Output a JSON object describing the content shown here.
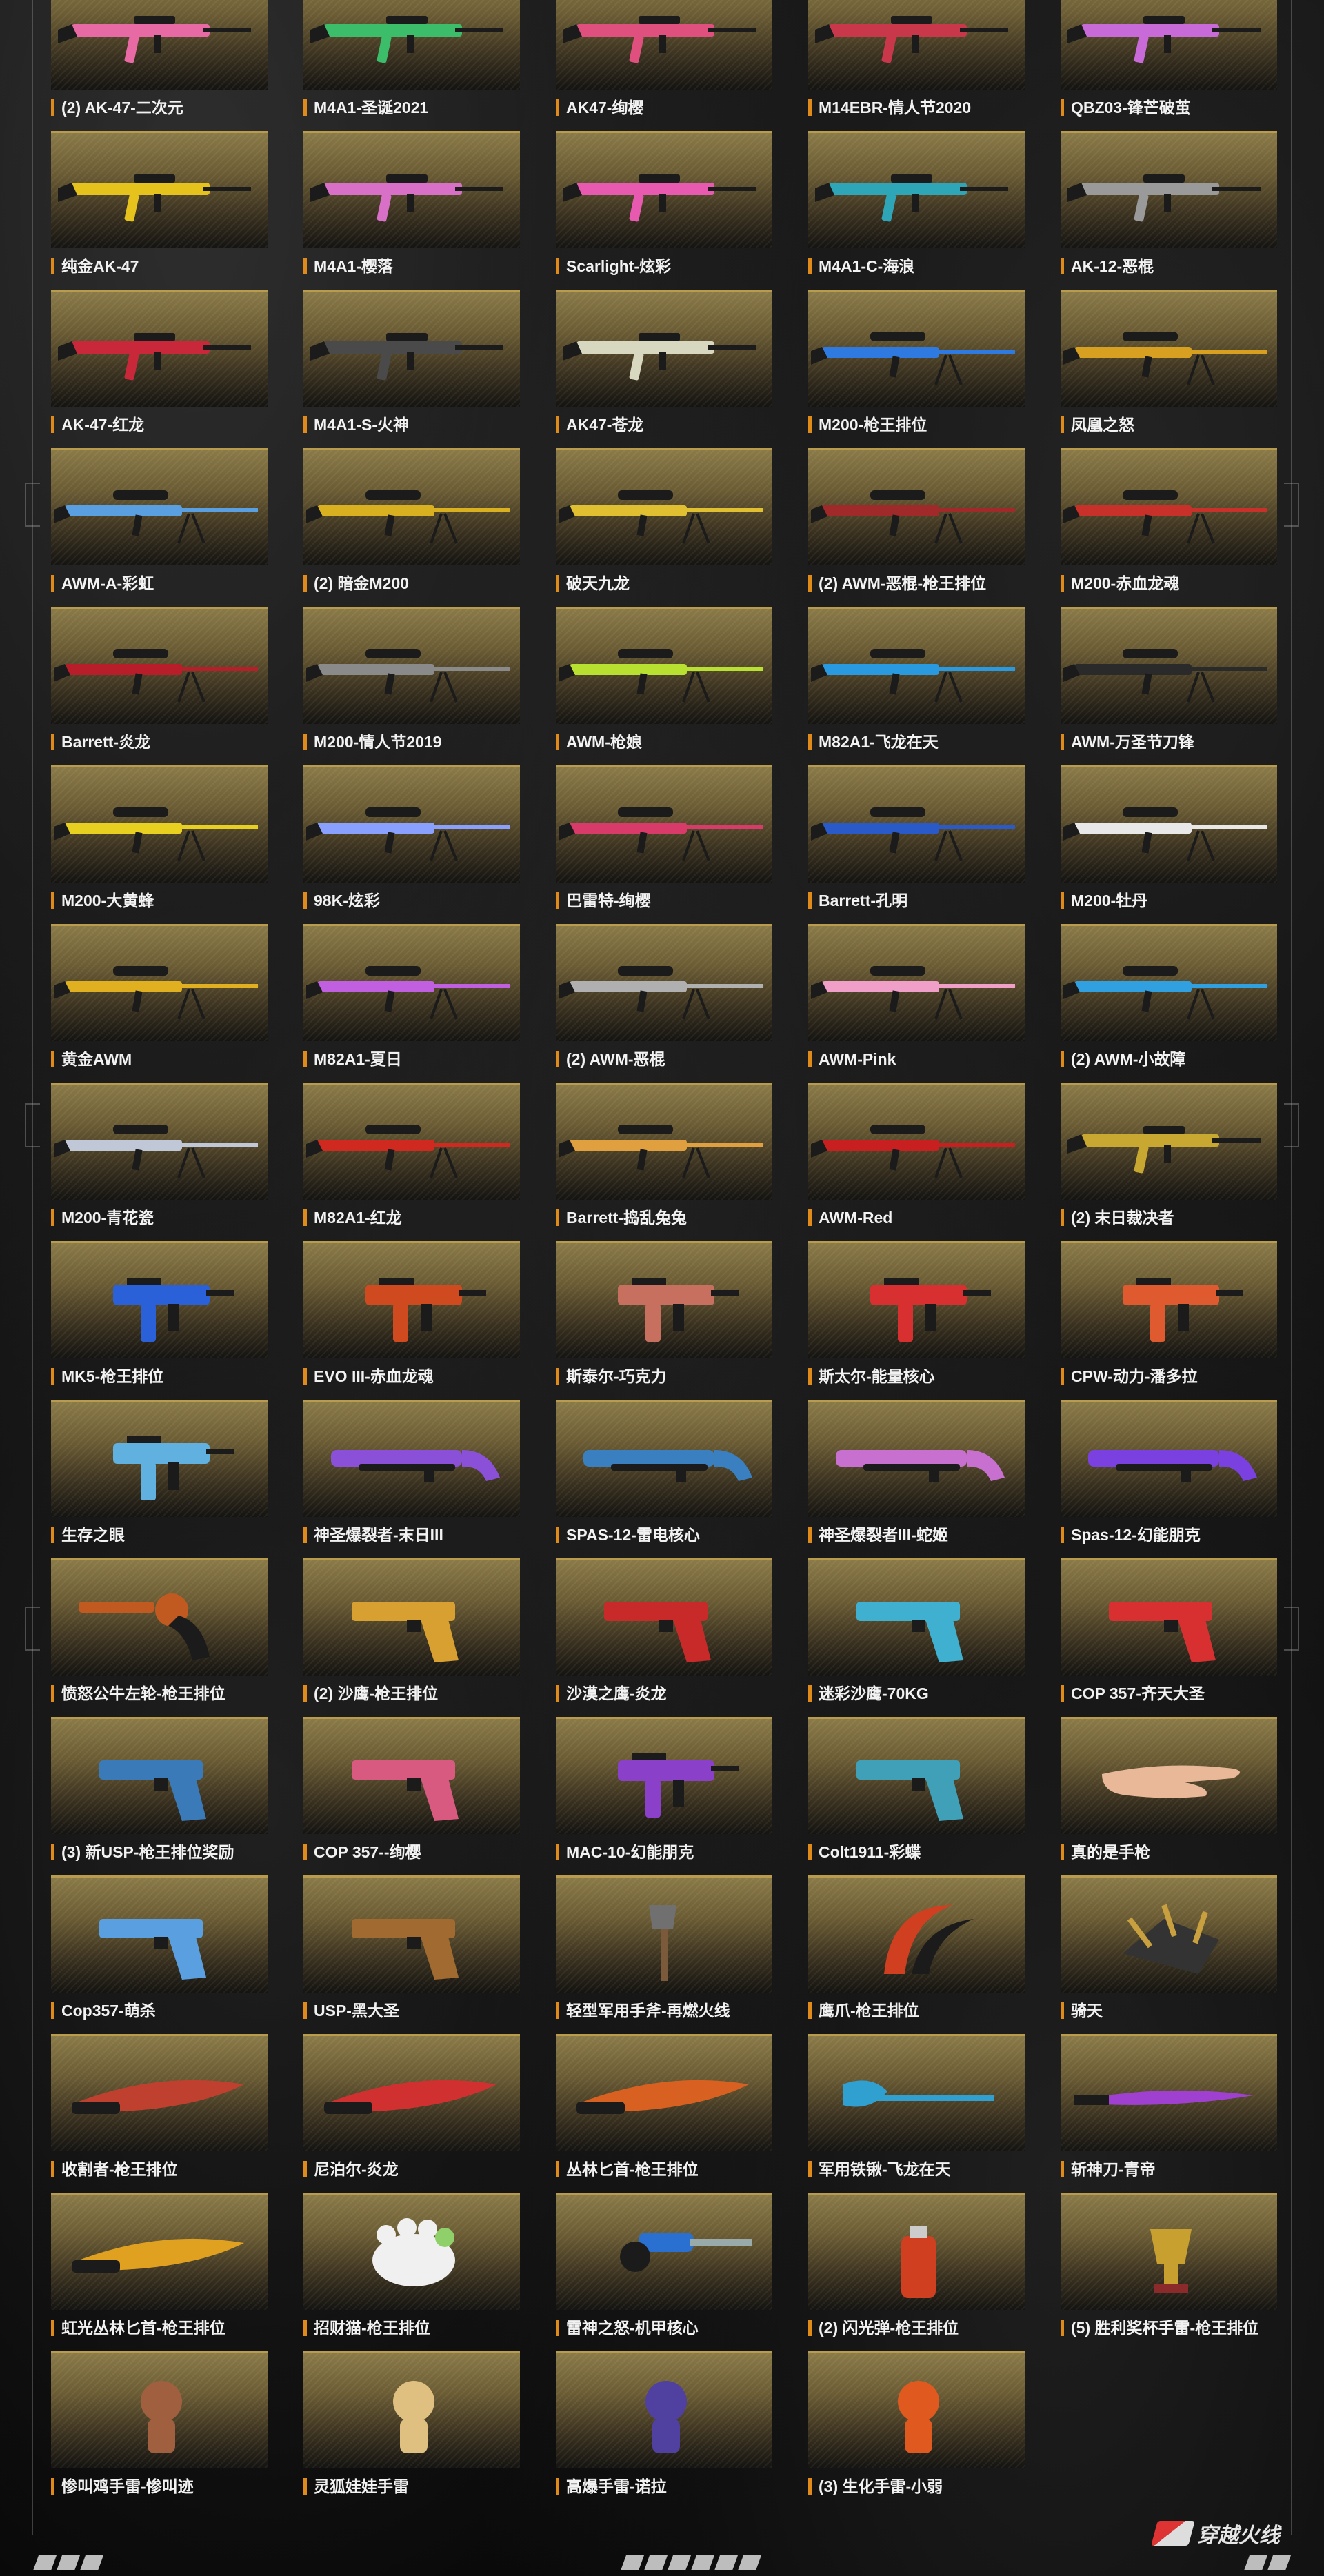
{
  "items": [
    {
      "label": "(2) AK-47-二次元",
      "icon": "rifle-icon",
      "color": "#e86aa5"
    },
    {
      "label": "M4A1-圣诞2021",
      "icon": "rifle-icon",
      "color": "#3bbd6a"
    },
    {
      "label": "AK47-绚樱",
      "icon": "rifle-icon",
      "color": "#e0507e"
    },
    {
      "label": "M14EBR-情人节2020",
      "icon": "rifle-icon",
      "color": "#c8384a"
    },
    {
      "label": "QBZ03-锋芒破茧",
      "icon": "rifle-icon",
      "color": "#c86ad8"
    },
    {
      "label": "纯金AK-47",
      "icon": "rifle-icon",
      "color": "#e6c21c"
    },
    {
      "label": "M4A1-樱落",
      "icon": "rifle-icon",
      "color": "#d870c8"
    },
    {
      "label": "Scarlight-炫彩",
      "icon": "rifle-icon",
      "color": "#e85ab0"
    },
    {
      "label": "M4A1-C-海浪",
      "icon": "rifle-icon",
      "color": "#2fa6b8"
    },
    {
      "label": "AK-12-恶棍",
      "icon": "rifle-icon",
      "color": "#9a9a9a"
    },
    {
      "label": "AK-47-红龙",
      "icon": "rifle-icon",
      "color": "#c8283a"
    },
    {
      "label": "M4A1-S-火神",
      "icon": "rifle-icon",
      "color": "#4a4a4a"
    },
    {
      "label": "AK47-苍龙",
      "icon": "rifle-icon",
      "color": "#d8d8c0"
    },
    {
      "label": "M200-枪王排位",
      "icon": "sniper-icon",
      "color": "#2f7ae0"
    },
    {
      "label": "凤凰之怒",
      "icon": "sniper-icon",
      "color": "#d8a020"
    },
    {
      "label": "AWM-A-彩虹",
      "icon": "sniper-icon",
      "color": "#5aa0e0"
    },
    {
      "label": "(2) 暗金M200",
      "icon": "sniper-icon",
      "color": "#d8b020"
    },
    {
      "label": "破天九龙",
      "icon": "sniper-icon",
      "color": "#e0c030"
    },
    {
      "label": "(2) AWM-恶棍-枪王排位",
      "icon": "sniper-icon",
      "color": "#a02a2a"
    },
    {
      "label": "M200-赤血龙魂",
      "icon": "sniper-icon",
      "color": "#c8302a"
    },
    {
      "label": "Barrett-炎龙",
      "icon": "sniper-icon",
      "color": "#b81e2a"
    },
    {
      "label": "M200-情人节2019",
      "icon": "sniper-icon",
      "color": "#8a8a8a"
    },
    {
      "label": "AWM-枪娘",
      "icon": "sniper-icon",
      "color": "#b8e030"
    },
    {
      "label": "M82A1-飞龙在天",
      "icon": "sniper-icon",
      "color": "#2a9ae0"
    },
    {
      "label": "AWM-万圣节刀锋",
      "icon": "sniper-icon",
      "color": "#2a2a2a"
    },
    {
      "label": "M200-大黄蜂",
      "icon": "sniper-icon",
      "color": "#e8d020"
    },
    {
      "label": "98K-炫彩",
      "icon": "sniper-icon",
      "color": "#8aa0ff"
    },
    {
      "label": "巴雷特-绚樱",
      "icon": "sniper-icon",
      "color": "#d83a6a"
    },
    {
      "label": "Barrett-孔明",
      "icon": "sniper-icon",
      "color": "#2a5ac8"
    },
    {
      "label": "M200-牡丹",
      "icon": "sniper-icon",
      "color": "#e8e8e8"
    },
    {
      "label": "黄金AWM",
      "icon": "sniper-icon",
      "color": "#e0b020"
    },
    {
      "label": "M82A1-夏日",
      "icon": "sniper-icon",
      "color": "#c060e0"
    },
    {
      "label": "(2) AWM-恶棍",
      "icon": "sniper-icon",
      "color": "#b0b0b0"
    },
    {
      "label": "AWM-Pink",
      "icon": "sniper-icon",
      "color": "#f0a0c8"
    },
    {
      "label": "(2) AWM-小故障",
      "icon": "sniper-icon",
      "color": "#30a0e0"
    },
    {
      "label": "M200-青花瓷",
      "icon": "sniper-icon",
      "color": "#c0c8d8"
    },
    {
      "label": "M82A1-红龙",
      "icon": "sniper-icon",
      "color": "#d02a20"
    },
    {
      "label": "Barrett-捣乱兔兔",
      "icon": "sniper-icon",
      "color": "#e0a040"
    },
    {
      "label": "AWM-Red",
      "icon": "sniper-icon",
      "color": "#c82020"
    },
    {
      "label": "(2) 末日裁决者",
      "icon": "rifle-icon",
      "color": "#c8a830"
    },
    {
      "label": "MK5-枪王排位",
      "icon": "smg-icon",
      "color": "#2a60d8"
    },
    {
      "label": "EVO III-赤血龙魂",
      "icon": "smg-icon",
      "color": "#d04a20"
    },
    {
      "label": "斯泰尔-巧克力",
      "icon": "smg-icon",
      "color": "#c87060"
    },
    {
      "label": "斯太尔-能量核心",
      "icon": "smg-icon",
      "color": "#d83030"
    },
    {
      "label": "CPW-动力-潘多拉",
      "icon": "smg-icon",
      "color": "#e05a30"
    },
    {
      "label": "生存之眼",
      "icon": "smg-icon",
      "color": "#60b0e0"
    },
    {
      "label": "神圣爆裂者-末日III",
      "icon": "shotgun-icon",
      "color": "#8a50d8"
    },
    {
      "label": "SPAS-12-雷电核心",
      "icon": "shotgun-icon",
      "color": "#3a80c0"
    },
    {
      "label": "神圣爆裂者III-蛇姬",
      "icon": "shotgun-icon",
      "color": "#c870d0"
    },
    {
      "label": "Spas-12-幻能朋克",
      "icon": "shotgun-icon",
      "color": "#7a40e0"
    },
    {
      "label": "愤怒公牛左轮-枪王排位",
      "icon": "revolver-icon",
      "color": "#c05a20"
    },
    {
      "label": "(2) 沙鹰-枪王排位",
      "icon": "pistol-icon",
      "color": "#d8a030"
    },
    {
      "label": "沙漠之鹰-炎龙",
      "icon": "pistol-icon",
      "color": "#c82a2a"
    },
    {
      "label": "迷彩沙鹰-70KG",
      "icon": "pistol-icon",
      "color": "#40b0d0"
    },
    {
      "label": "COP 357-齐天大圣",
      "icon": "pistol-icon",
      "color": "#d83030"
    },
    {
      "label": "(3) 新USP-枪王排位奖励",
      "icon": "pistol-icon",
      "color": "#3a7ab8"
    },
    {
      "label": "COP 357--绚樱",
      "icon": "pistol-icon",
      "color": "#d85a80"
    },
    {
      "label": "MAC-10-幻能朋克",
      "icon": "smg-icon",
      "color": "#8a40c8"
    },
    {
      "label": "Colt1911-彩蝶",
      "icon": "pistol-icon",
      "color": "#40a0b8"
    },
    {
      "label": "真的是手枪",
      "icon": "hand-icon",
      "color": "#e8b898"
    },
    {
      "label": "Cop357-萌杀",
      "icon": "pistol-icon",
      "color": "#5aa0e0"
    },
    {
      "label": "USP-黑大圣",
      "icon": "pistol-icon",
      "color": "#a06a30"
    },
    {
      "label": "轻型军用手斧-再燃火线",
      "icon": "axe-icon",
      "color": "#707070"
    },
    {
      "label": "鹰爪-枪王排位",
      "icon": "karambit-icon",
      "color": "#d04020"
    },
    {
      "label": "骑天",
      "icon": "claw-icon",
      "color": "#c8a040"
    },
    {
      "label": "收割者-枪王排位",
      "icon": "knife-icon",
      "color": "#c04030"
    },
    {
      "label": "尼泊尔-炎龙",
      "icon": "knife-icon",
      "color": "#d03030"
    },
    {
      "label": "丛林匕首-枪王排位",
      "icon": "knife-icon",
      "color": "#d86020"
    },
    {
      "label": "军用铁锹-飞龙在天",
      "icon": "shovel-icon",
      "color": "#30a0d0"
    },
    {
      "label": "斩神刀-青帝",
      "icon": "blade-icon",
      "color": "#a040d0"
    },
    {
      "label": "虹光丛林匕首-枪王排位",
      "icon": "knife-icon",
      "color": "#e0a020"
    },
    {
      "label": "招财猫-枪王排位",
      "icon": "paw-icon",
      "color": "#f0f0f0"
    },
    {
      "label": "雷神之怒-机甲核心",
      "icon": "grenade-icon",
      "color": "#2a70d0"
    },
    {
      "label": "(2) 闪光弹-枪王排位",
      "icon": "flashbang-icon",
      "color": "#d04020"
    },
    {
      "label": "(5) 胜利奖杯手雷-枪王排位",
      "icon": "trophy-icon",
      "color": "#c8a030"
    },
    {
      "label": "惨叫鸡手雷-惨叫迹",
      "icon": "doll-icon",
      "color": "#a06040"
    },
    {
      "label": "灵狐娃娃手雷",
      "icon": "doll-icon",
      "color": "#e0c080"
    },
    {
      "label": "高爆手雷-诺拉",
      "icon": "doll-icon",
      "color": "#5040a0"
    },
    {
      "label": "(3) 生化手雷-小弱",
      "icon": "doll-icon",
      "color": "#e05a20"
    }
  ],
  "logo": {
    "text": "穿越火线"
  }
}
